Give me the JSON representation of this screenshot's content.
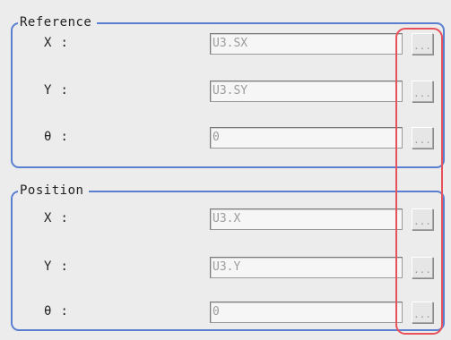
{
  "reference": {
    "title": "Reference",
    "rows": [
      {
        "label": "X",
        "separator": ":",
        "value": "U3.SX",
        "button_label": "..."
      },
      {
        "label": "Y",
        "separator": ":",
        "value": "U3.SY",
        "button_label": "..."
      },
      {
        "label": "θ",
        "separator": ":",
        "value": "0",
        "button_label": "..."
      }
    ]
  },
  "position": {
    "title": "Position",
    "rows": [
      {
        "label": "X",
        "separator": ":",
        "value": "U3.X",
        "button_label": "..."
      },
      {
        "label": "Y",
        "separator": ":",
        "value": "U3.Y",
        "button_label": "..."
      },
      {
        "label": "θ",
        "separator": ":",
        "value": "0",
        "button_label": "..."
      }
    ]
  },
  "colors": {
    "group_border": "#5a7fd0",
    "highlight_border": "#e8505a",
    "disabled_text": "#9c9c9c"
  }
}
